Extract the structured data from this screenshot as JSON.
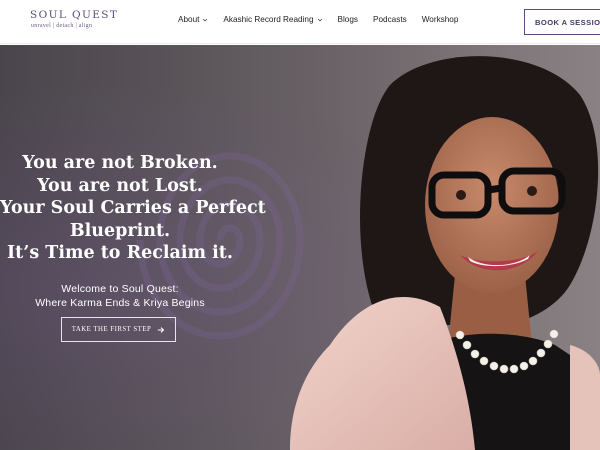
{
  "header": {
    "logo_title": "SOUL QUEST",
    "logo_tagline": "unravel  |  detach  |  align",
    "nav": [
      {
        "label": "About",
        "has_dropdown": true
      },
      {
        "label": "Akashic Record Reading",
        "has_dropdown": true
      },
      {
        "label": "Blogs",
        "has_dropdown": false
      },
      {
        "label": "Podcasts",
        "has_dropdown": false
      },
      {
        "label": "Workshop",
        "has_dropdown": false
      }
    ],
    "book_button": "BOOK A SESSION"
  },
  "hero": {
    "headline_lines": [
      "You are not Broken.",
      "You are not Lost.",
      "Your Soul Carries a Perfect",
      "Blueprint.",
      "It’s Time to Reclaim it."
    ],
    "welcome_lines": [
      "Welcome to Soul Quest:",
      "Where Karma Ends & Kriya Begins"
    ],
    "cta_label": "TAKE THE FIRST STEP",
    "cta_icon": "arrow-right-icon"
  },
  "colors": {
    "brand_purple": "#5e4a78",
    "header_bg": "#ffffff",
    "hero_text": "#ffffff"
  }
}
